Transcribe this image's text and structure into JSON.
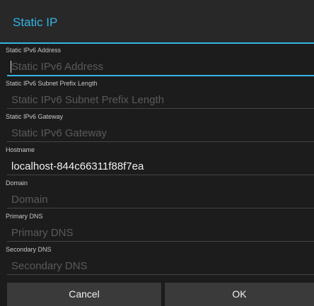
{
  "dialog": {
    "title": "Static IP",
    "accent_color": "#33b5e5"
  },
  "fields": [
    {
      "label": "Static IPv6 Address",
      "value": "",
      "placeholder": "Static IPv6 Address",
      "focused": true
    },
    {
      "label": "Static IPv6 Subnet Prefix Length",
      "value": "",
      "placeholder": "Static IPv6 Subnet Prefix Length"
    },
    {
      "label": "Static IPv6 Gateway",
      "value": "",
      "placeholder": "Static IPv6 Gateway"
    },
    {
      "label": "Hostname",
      "value": "localhost-844c66311f88f7ea",
      "placeholder": "Hostname"
    },
    {
      "label": "Domain",
      "value": "",
      "placeholder": "Domain"
    },
    {
      "label": "Primary DNS",
      "value": "",
      "placeholder": "Primary DNS"
    },
    {
      "label": "Secondary DNS",
      "value": "",
      "placeholder": "Secondary DNS"
    }
  ],
  "buttons": {
    "cancel_label": "Cancel",
    "ok_label": "OK"
  }
}
